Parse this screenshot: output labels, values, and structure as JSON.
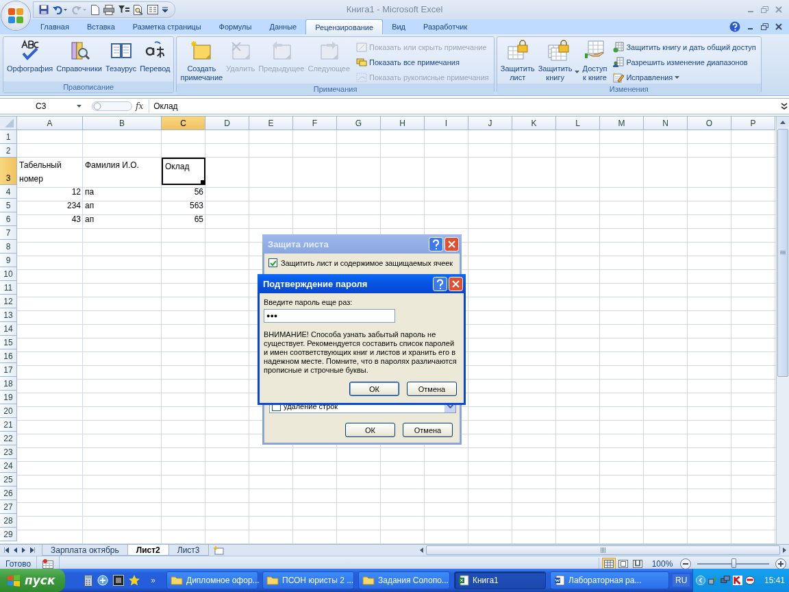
{
  "window": {
    "title": "Книга1 - Microsoft Excel"
  },
  "ribbon_tabs": [
    {
      "label": "Главная",
      "selected": false
    },
    {
      "label": "Вставка",
      "selected": false
    },
    {
      "label": "Разметка страницы",
      "selected": false
    },
    {
      "label": "Формулы",
      "selected": false
    },
    {
      "label": "Данные",
      "selected": false
    },
    {
      "label": "Рецензирование",
      "selected": true
    },
    {
      "label": "Вид",
      "selected": false
    },
    {
      "label": "Разработчик",
      "selected": false
    }
  ],
  "ribbon_groups": [
    {
      "title": "Правописание",
      "large": [
        {
          "label": "Орфография",
          "disabled": false,
          "dropdown": false
        },
        {
          "label": "Справочники",
          "disabled": false,
          "dropdown": false
        },
        {
          "label": "Тезаурус",
          "disabled": false,
          "dropdown": false
        },
        {
          "label": "Перевод",
          "disabled": false,
          "dropdown": false
        }
      ]
    },
    {
      "title": "Примечания",
      "large": [
        {
          "label": "Создать\nпримечание",
          "disabled": false,
          "dropdown": false
        },
        {
          "label": "Удалить",
          "disabled": true,
          "dropdown": false
        },
        {
          "label": "Предыдущее",
          "disabled": true,
          "dropdown": false
        },
        {
          "label": "Следующее",
          "disabled": true,
          "dropdown": false
        }
      ],
      "small": [
        {
          "label": "Показать или скрыть примечание",
          "disabled": true,
          "dropdown": false
        },
        {
          "label": "Показать все примечания",
          "disabled": false,
          "dropdown": false
        },
        {
          "label": "Показать рукописные примечания",
          "disabled": true,
          "dropdown": false
        }
      ]
    },
    {
      "title": "Изменения",
      "large": [
        {
          "label": "Защитить\nлист",
          "disabled": false,
          "dropdown": false
        },
        {
          "label": "Защитить\nкнигу",
          "disabled": false,
          "dropdown": true
        },
        {
          "label": "Доступ\nк книге",
          "disabled": false,
          "dropdown": false
        }
      ],
      "small": [
        {
          "label": "Защитить книгу и дать общий доступ",
          "disabled": false,
          "dropdown": false
        },
        {
          "label": "Разрешить изменение диапазонов",
          "disabled": false,
          "dropdown": false
        },
        {
          "label": "Исправления",
          "disabled": false,
          "dropdown": true
        }
      ]
    }
  ],
  "formula_bar": {
    "name_box": "C3",
    "fx": "fx",
    "formula": "Оклад"
  },
  "columns": [
    {
      "label": "A",
      "selected": false
    },
    {
      "label": "B",
      "selected": false
    },
    {
      "label": "C",
      "selected": true
    },
    {
      "label": "D",
      "selected": false
    },
    {
      "label": "E",
      "selected": false
    },
    {
      "label": "F",
      "selected": false
    },
    {
      "label": "G",
      "selected": false
    },
    {
      "label": "H",
      "selected": false
    },
    {
      "label": "I",
      "selected": false
    },
    {
      "label": "J",
      "selected": false
    },
    {
      "label": "K",
      "selected": false
    },
    {
      "label": "L",
      "selected": false
    },
    {
      "label": "M",
      "selected": false
    },
    {
      "label": "N",
      "selected": false
    },
    {
      "label": "O",
      "selected": false
    },
    {
      "label": "P",
      "selected": false
    }
  ],
  "rows": [
    {
      "number": "1",
      "selected": false,
      "tall": false,
      "cells": []
    },
    {
      "number": "2",
      "selected": false,
      "tall": false,
      "cells": []
    },
    {
      "number": "3",
      "selected": true,
      "tall": true,
      "cells": [
        {
          "value": "Табельный номер",
          "kind": "text",
          "selected": false
        },
        {
          "value": "Фамилия И.О.",
          "kind": "text",
          "selected": false
        },
        {
          "value": "Оклад",
          "kind": "text",
          "selected": true
        }
      ]
    },
    {
      "number": "4",
      "selected": false,
      "tall": false,
      "cells": [
        {
          "value": "12",
          "kind": "number",
          "selected": false
        },
        {
          "value": "па",
          "kind": "text",
          "selected": false
        },
        {
          "value": "56",
          "kind": "number",
          "selected": false
        }
      ]
    },
    {
      "number": "5",
      "selected": false,
      "tall": false,
      "cells": [
        {
          "value": "234",
          "kind": "number",
          "selected": false
        },
        {
          "value": "ап",
          "kind": "text",
          "selected": false
        },
        {
          "value": "563",
          "kind": "number",
          "selected": false
        }
      ]
    },
    {
      "number": "6",
      "selected": false,
      "tall": false,
      "cells": [
        {
          "value": "43",
          "kind": "number",
          "selected": false
        },
        {
          "value": "ап",
          "kind": "text",
          "selected": false
        },
        {
          "value": "65",
          "kind": "number",
          "selected": false
        }
      ]
    },
    {
      "number": "7",
      "selected": false,
      "tall": false,
      "cells": []
    },
    {
      "number": "8",
      "selected": false,
      "tall": false,
      "cells": []
    },
    {
      "number": "9",
      "selected": false,
      "tall": false,
      "cells": []
    },
    {
      "number": "10",
      "selected": false,
      "tall": false,
      "cells": []
    },
    {
      "number": "11",
      "selected": false,
      "tall": false,
      "cells": []
    },
    {
      "number": "12",
      "selected": false,
      "tall": false,
      "cells": []
    },
    {
      "number": "13",
      "selected": false,
      "tall": false,
      "cells": []
    },
    {
      "number": "14",
      "selected": false,
      "tall": false,
      "cells": []
    },
    {
      "number": "15",
      "selected": false,
      "tall": false,
      "cells": []
    },
    {
      "number": "16",
      "selected": false,
      "tall": false,
      "cells": []
    },
    {
      "number": "17",
      "selected": false,
      "tall": false,
      "cells": []
    },
    {
      "number": "18",
      "selected": false,
      "tall": false,
      "cells": []
    },
    {
      "number": "19",
      "selected": false,
      "tall": false,
      "cells": []
    },
    {
      "number": "20",
      "selected": false,
      "tall": false,
      "cells": []
    },
    {
      "number": "21",
      "selected": false,
      "tall": false,
      "cells": []
    },
    {
      "number": "22",
      "selected": false,
      "tall": false,
      "cells": []
    },
    {
      "number": "23",
      "selected": false,
      "tall": false,
      "cells": []
    },
    {
      "number": "24",
      "selected": false,
      "tall": false,
      "cells": []
    },
    {
      "number": "25",
      "selected": false,
      "tall": false,
      "cells": []
    },
    {
      "number": "26",
      "selected": false,
      "tall": false,
      "cells": []
    },
    {
      "number": "27",
      "selected": false,
      "tall": false,
      "cells": []
    },
    {
      "number": "28",
      "selected": false,
      "tall": false,
      "cells": []
    },
    {
      "number": "29",
      "selected": false,
      "tall": false,
      "cells": []
    }
  ],
  "sheet_tabs": [
    {
      "label": "Зарплата октябрь",
      "selected": false
    },
    {
      "label": "Лист2",
      "selected": true
    },
    {
      "label": "Лист3",
      "selected": false
    }
  ],
  "status_bar": {
    "status": "Готово",
    "views": [
      {
        "selected": true
      },
      {
        "selected": false
      },
      {
        "selected": false
      }
    ],
    "zoom": "100%",
    "zoom_slider": {
      "level": 0.5
    }
  },
  "protect_dialog": {
    "title": "Защита листа",
    "checkbox": {
      "label": "Защитить лист и содержимое защищаемых ячеек",
      "checked": true
    },
    "list_item": {
      "label": "удаление строк",
      "checked": false
    },
    "buttons": [
      "ОК",
      "Отмена"
    ]
  },
  "password_dialog": {
    "title": "Подтверждение пароля",
    "prompt": "Введите пароль еще раз:",
    "value": "●●●",
    "warning": "ВНИМАНИЕ! Способа узнать забытый пароль не существует. Рекомендуется составить список паролей и имен соответствующих книг и листов и хранить его в надежном месте. Помните, что в паролях различаются прописные и строчные буквы.",
    "buttons": [
      "ОК",
      "Отмена"
    ]
  },
  "taskbar": {
    "start": "пуск",
    "chevron": "»",
    "tasks": [
      {
        "label": "Дипломное офор...",
        "kind": "folder",
        "selected": false
      },
      {
        "label": "ПСОН юристы 2 ...",
        "kind": "folder",
        "selected": false
      },
      {
        "label": "Задания Солопо...",
        "kind": "folder",
        "selected": false
      },
      {
        "label": "Книга1",
        "kind": "excel",
        "selected": true
      },
      {
        "label": "Лабораторная ра...",
        "kind": "word",
        "selected": false
      }
    ],
    "language": "RU",
    "clock": "15:41"
  }
}
